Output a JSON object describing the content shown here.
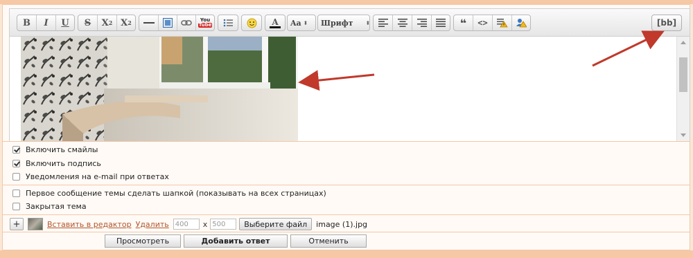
{
  "toolbar": {
    "bold": "B",
    "italic": "I",
    "underline": "U",
    "strike": "S",
    "superscript_base": "X",
    "superscript_mark": "2",
    "subscript_base": "X",
    "subscript_mark": "2",
    "youtube_top": "You",
    "youtube_bottom": "Tube",
    "font_color_letter": "A",
    "font_size_label": "Aa",
    "font_family_label": "Шрифт",
    "bbcode_toggle": "[bb]",
    "accent_color": "#c0392b",
    "icons": [
      "horizontal-rule-icon",
      "image-icon",
      "link-icon",
      "youtube-icon",
      "list-icon",
      "smiley-icon",
      "font-color-icon",
      "align-left-icon",
      "align-center-icon",
      "align-right-icon",
      "align-justify-icon",
      "quote-icon",
      "code-icon",
      "spoiler-icon",
      "hide-user-icon"
    ]
  },
  "options": {
    "enable_smilies": {
      "label": "Включить смайлы",
      "checked": true
    },
    "enable_signature": {
      "label": "Включить подпись",
      "checked": true
    },
    "email_notify": {
      "label": "Уведомления на e-mail при ответах",
      "checked": false
    },
    "first_post_header": {
      "label": "Первое сообщение темы сделать шапкой (показывать на всех страницах)",
      "checked": false
    },
    "closed_topic": {
      "label": "Закрытая тема",
      "checked": false
    }
  },
  "attachment": {
    "add_label": "+",
    "insert_link": "Вставить в редактор",
    "delete_link": "Удалить",
    "width_placeholder": "400",
    "times": "x",
    "height_placeholder": "500",
    "choose_file": "Выберите файл",
    "file_name": "image (1).jpg"
  },
  "actions": {
    "preview": "Просмотреть",
    "submit": "Добавить ответ",
    "cancel": "Отменить"
  }
}
